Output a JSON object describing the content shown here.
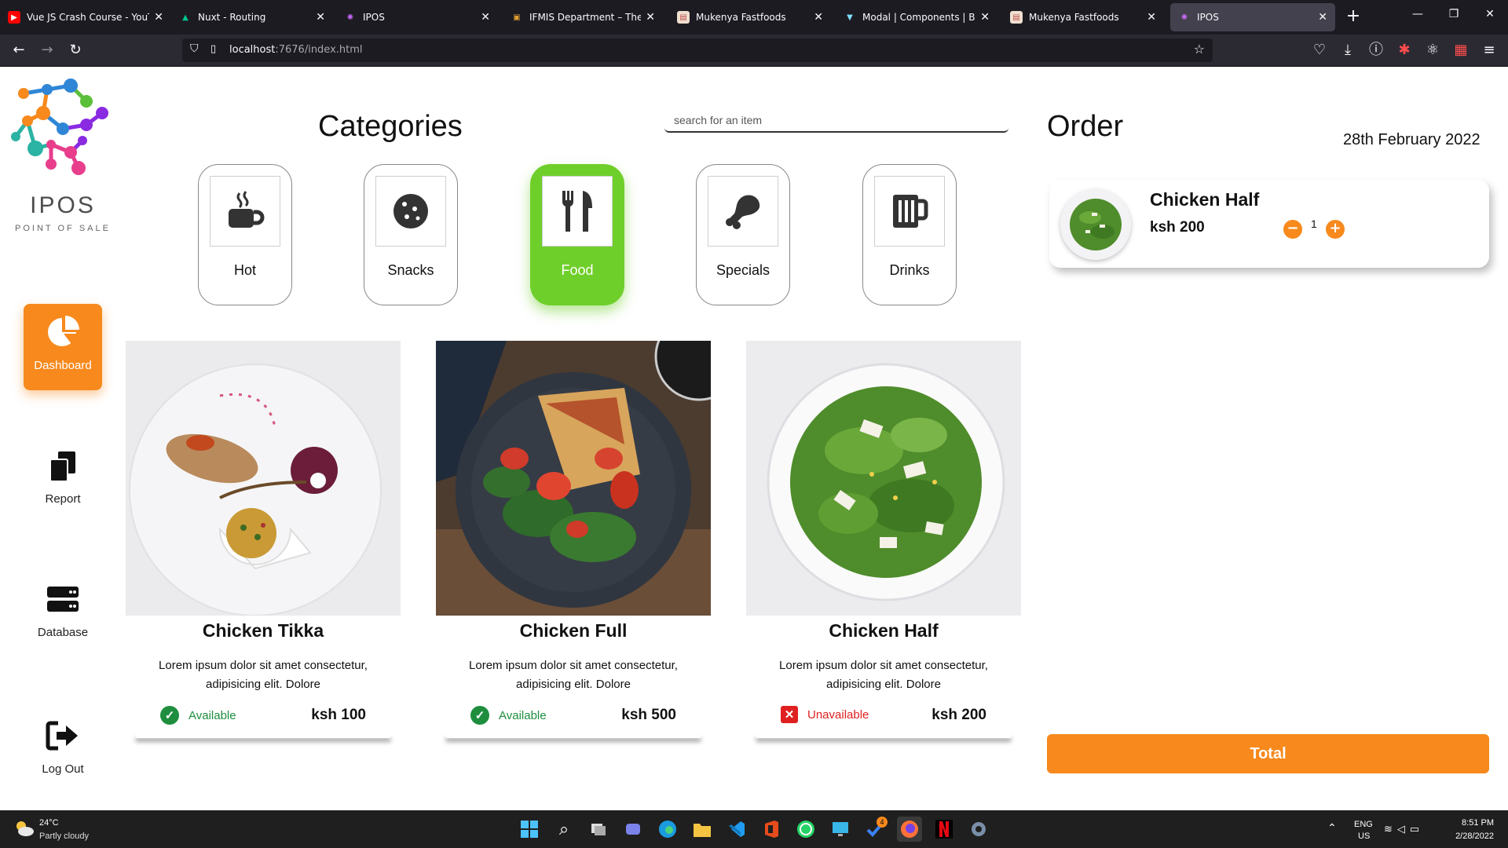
{
  "browser": {
    "tabs": [
      {
        "title": "Vue JS Crash Course - YouTube",
        "fav_color": "#ff0000",
        "fav_glyph": "▶"
      },
      {
        "title": "Nuxt - Routing",
        "fav_color": "#00c58e",
        "fav_glyph": "▲"
      },
      {
        "title": "IPOS",
        "fav_color": "#8a2be2",
        "fav_glyph": "✺"
      },
      {
        "title": "IFMIS Department – The National Treasury",
        "fav_color": "#b8860b",
        "fav_glyph": "▣"
      },
      {
        "title": "Mukenya Fastfoods",
        "fav_color": "#c0504d",
        "fav_glyph": "▤"
      },
      {
        "title": "Modal | Components | Bootstrap",
        "fav_color": "#563d7c",
        "fav_glyph": "▼"
      },
      {
        "title": "Mukenya Fastfoods",
        "fav_color": "#c0504d",
        "fav_glyph": "▤"
      },
      {
        "title": "IPOS",
        "fav_color": "#8a2be2",
        "fav_glyph": "✺"
      }
    ],
    "url_host": "localhost",
    "url_rest": ":7676/index.html"
  },
  "sidebar": {
    "brand": "IPOS",
    "brand_sub": "POINT OF SALE",
    "items": [
      {
        "label": "Dashboard",
        "icon": "pie-chart-icon"
      },
      {
        "label": "Report",
        "icon": "copy-icon"
      },
      {
        "label": "Database",
        "icon": "server-icon"
      },
      {
        "label": "Log Out",
        "icon": "logout-icon"
      }
    ]
  },
  "categories": {
    "title": "Categories",
    "search_placeholder": "search for an item",
    "items": [
      {
        "label": "Hot",
        "icon": "mug-icon",
        "active": false
      },
      {
        "label": "Snacks",
        "icon": "cookie-icon",
        "active": false
      },
      {
        "label": "Food",
        "icon": "utensils-icon",
        "active": true
      },
      {
        "label": "Specials",
        "icon": "drumstick-icon",
        "active": false
      },
      {
        "label": "Drinks",
        "icon": "beer-icon",
        "active": false
      }
    ]
  },
  "products": [
    {
      "name": "Chicken Tikka",
      "description": "Lorem ipsum dolor sit amet consectetur, adipisicing elit. Dolore",
      "status": "Available",
      "available": true,
      "price": "ksh 100"
    },
    {
      "name": "Chicken Full",
      "description": "Lorem ipsum dolor sit amet consectetur, adipisicing elit. Dolore",
      "status": "Available",
      "available": true,
      "price": "ksh 500"
    },
    {
      "name": "Chicken Half",
      "description": "Lorem ipsum dolor sit amet consectetur, adipisicing elit. Dolore",
      "status": "Unavailable",
      "available": false,
      "price": "ksh 200"
    }
  ],
  "order": {
    "title": "Order",
    "date": "28th February 2022",
    "items": [
      {
        "name": "Chicken Half",
        "price": "ksh 200",
        "qty": "1",
        "minus": "−",
        "plus": "+"
      }
    ],
    "total_label": "Total"
  },
  "taskbar": {
    "temp": "24°C",
    "weather": "Partly cloudy",
    "lang1": "ENG",
    "lang2": "US",
    "time": "8:51 PM",
    "date": "2/28/2022",
    "firefox_badge": "4"
  },
  "colors": {
    "accent": "#f7891d",
    "active_category": "#6fcf2a",
    "available": "#1e8e3e",
    "unavailable": "#e02020"
  }
}
